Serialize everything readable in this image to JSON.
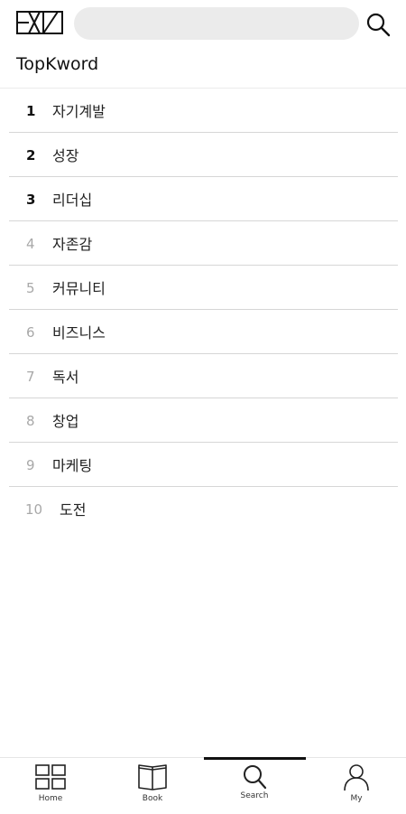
{
  "header": {
    "logo_text": "EXZ",
    "search_placeholder": "",
    "search_value": ""
  },
  "section": {
    "title": "TopKword"
  },
  "keywords": [
    {
      "rank": "1",
      "label": "자기계발"
    },
    {
      "rank": "2",
      "label": "성장"
    },
    {
      "rank": "3",
      "label": "리더십"
    },
    {
      "rank": "4",
      "label": "자존감"
    },
    {
      "rank": "5",
      "label": "커뮤니티"
    },
    {
      "rank": "6",
      "label": "비즈니스"
    },
    {
      "rank": "7",
      "label": "독서"
    },
    {
      "rank": "8",
      "label": "창업"
    },
    {
      "rank": "9",
      "label": "마케팅"
    },
    {
      "rank": "10",
      "label": "도전"
    }
  ],
  "nav": {
    "items": [
      {
        "label": "Home",
        "icon": "grid-icon"
      },
      {
        "label": "Book",
        "icon": "book-icon"
      },
      {
        "label": "Search",
        "icon": "search-icon"
      },
      {
        "label": "My",
        "icon": "person-icon"
      }
    ],
    "active": "Search"
  },
  "colors": {
    "top_rank": "#111111",
    "dim_rank": "#a8a8a8",
    "search_bar": "#ebebeb",
    "divider": "#d6d6d6",
    "active_indicator": "#111111"
  }
}
